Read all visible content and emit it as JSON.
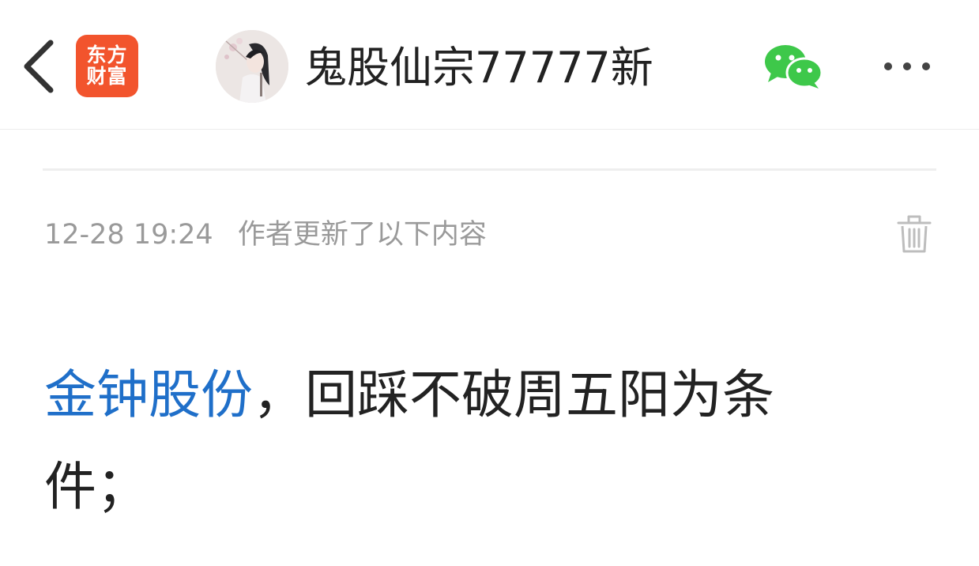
{
  "header": {
    "brand_logo_line1": "东方",
    "brand_logo_line2": "财富",
    "author_name": "鬼股仙宗77777新"
  },
  "update": {
    "time": "12-28 19:24",
    "text": "作者更新了以下内容"
  },
  "content": {
    "stock_name": "金钟股份",
    "text": "，回踩不破周五阳为条件；"
  },
  "colors": {
    "brand": "#f2542d",
    "link": "#1f6fc9",
    "wechat": "#3ec84a",
    "meta_text": "#9a9a9a"
  },
  "icons": {
    "back": "chevron-left-icon",
    "wechat": "wechat-icon",
    "more": "more-horizontal-icon",
    "trash": "trash-icon"
  }
}
